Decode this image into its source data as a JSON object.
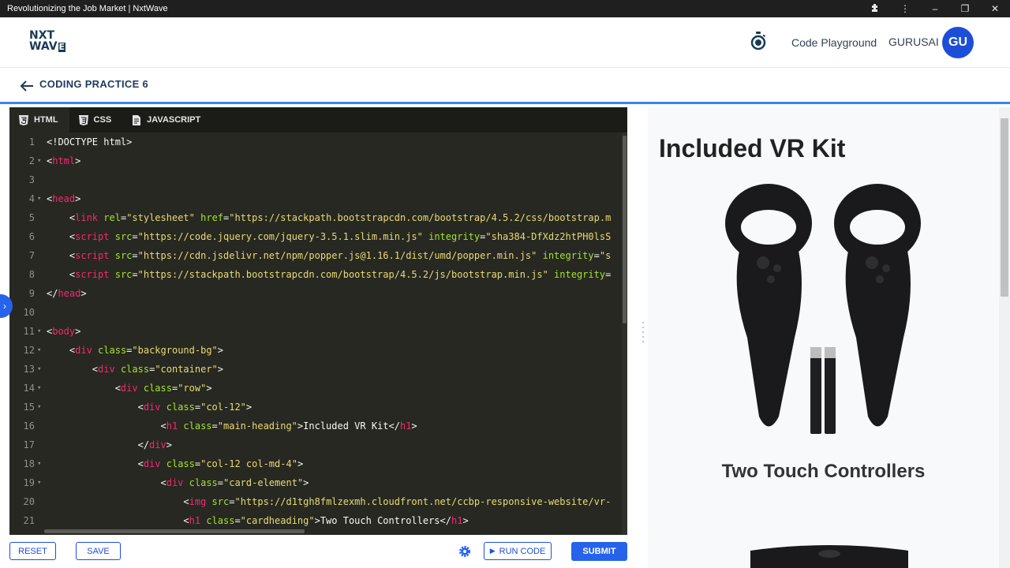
{
  "window": {
    "title": "Revolutionizing the Job Market | NxtWave"
  },
  "header": {
    "logo_line1": "NXT",
    "logo_line2_a": "WAV",
    "logo_line2_b": "E",
    "nav_link": "Code Playground",
    "user_name": "GURUSAI",
    "avatar_initials": "GU"
  },
  "breadcrumb": {
    "title": "CODING PRACTICE 6"
  },
  "editor": {
    "tabs": [
      {
        "label": "HTML",
        "icon": "html5-icon"
      },
      {
        "label": "CSS",
        "icon": "css3-icon"
      },
      {
        "label": "JAVASCRIPT",
        "icon": "js-file-icon"
      }
    ],
    "active_tab": "HTML",
    "lines": [
      {
        "n": "1",
        "text": "<!DOCTYPE html>"
      },
      {
        "n": "2",
        "text": "<html>"
      },
      {
        "n": "3",
        "text": ""
      },
      {
        "n": "4",
        "text": "<head>"
      },
      {
        "n": "5",
        "text": "    <link rel=\"stylesheet\" href=\"https://stackpath.bootstrapcdn.com/bootstrap/4.5.2/css/bootstrap.m"
      },
      {
        "n": "6",
        "text": "    <script src=\"https://code.jquery.com/jquery-3.5.1.slim.min.js\" integrity=\"sha384-DfXdz2htPH0lsS"
      },
      {
        "n": "7",
        "text": "    <script src=\"https://cdn.jsdelivr.net/npm/popper.js@1.16.1/dist/umd/popper.min.js\" integrity=\"s"
      },
      {
        "n": "8",
        "text": "    <script src=\"https://stackpath.bootstrapcdn.com/bootstrap/4.5.2/js/bootstrap.min.js\" integrity="
      },
      {
        "n": "9",
        "text": "</head>"
      },
      {
        "n": "10",
        "text": ""
      },
      {
        "n": "11",
        "text": "<body>"
      },
      {
        "n": "12",
        "text": "    <div class=\"background-bg\">"
      },
      {
        "n": "13",
        "text": "        <div class=\"container\">"
      },
      {
        "n": "14",
        "text": "            <div class=\"row\">"
      },
      {
        "n": "15",
        "text": "                <div class=\"col-12\">"
      },
      {
        "n": "16",
        "text": "                    <h1 class=\"main-heading\">Included VR Kit</h1>"
      },
      {
        "n": "17",
        "text": "                </div>"
      },
      {
        "n": "18",
        "text": "                <div class=\"col-12 col-md-4\">"
      },
      {
        "n": "19",
        "text": "                    <div class=\"card-element\">"
      },
      {
        "n": "20",
        "text": "                        <img src=\"https://d1tgh8fmlzexmh.cloudfront.net/ccbp-responsive-website/vr-"
      },
      {
        "n": "21",
        "text": "                        <h1 class=\"cardheading\">Two Touch Controllers</h1>"
      }
    ],
    "folded_lines": [
      "2",
      "4",
      "11",
      "12",
      "13",
      "14",
      "15",
      "18",
      "19"
    ]
  },
  "actions": {
    "reset_label": "RESET",
    "save_label": "SAVE",
    "run_label": "RUN CODE",
    "submit_label": "SUBMIT"
  },
  "preview": {
    "main_heading": "Included VR Kit",
    "card_heading": "Two Touch Controllers"
  },
  "colors": {
    "accent": "#2563eb",
    "editor_bg": "#272822",
    "tag": "#f92672",
    "attr": "#a6e22e",
    "string": "#e6db74"
  }
}
